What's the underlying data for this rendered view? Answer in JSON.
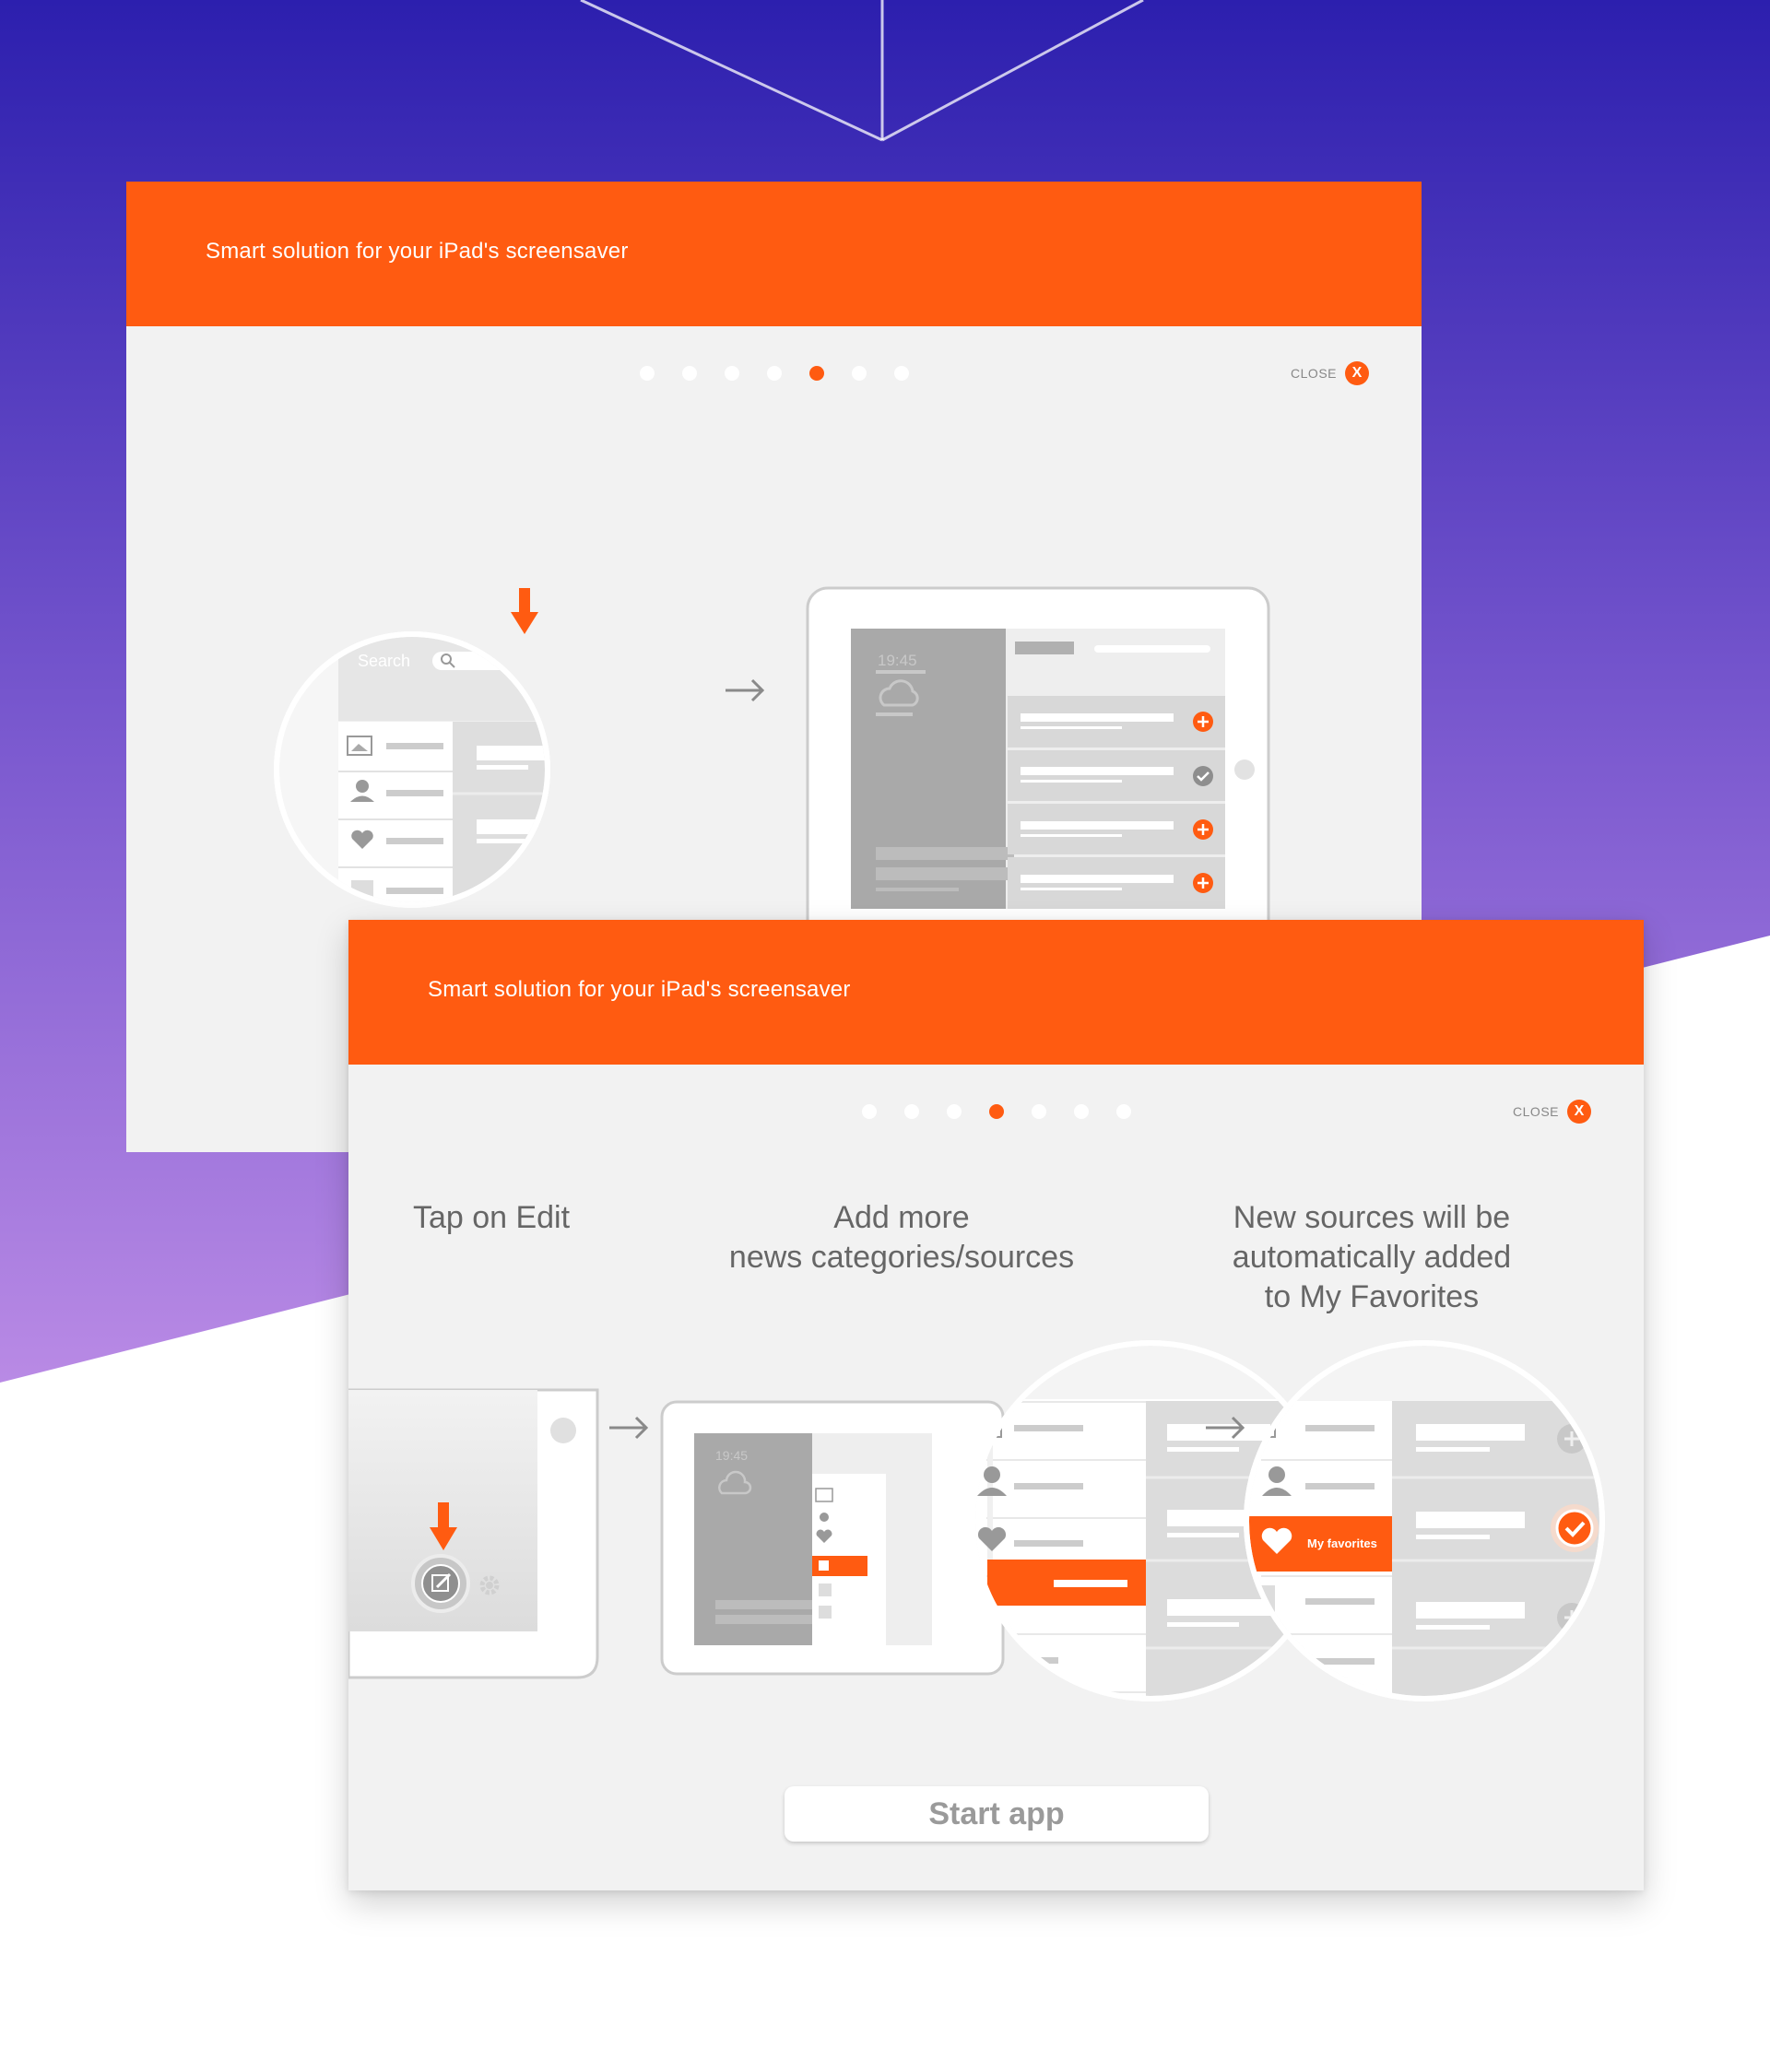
{
  "colors": {
    "accent": "#ff5b11",
    "panel": "#f2f2f2",
    "gradient_top": "#2c1fae",
    "gradient_bottom": "#b98ae5"
  },
  "back_panel": {
    "title": "Smart solution for your iPad's screensaver",
    "pagination": {
      "total": 7,
      "active": 5
    },
    "close_label": "CLOSE",
    "close_icon": "X",
    "search_placeholder": "Search",
    "clock": "19:45"
  },
  "front_panel": {
    "title": "Smart solution for your iPad's screensaver",
    "pagination": {
      "total": 7,
      "active": 4
    },
    "close_label": "CLOSE",
    "close_icon": "X",
    "steps": [
      {
        "caption": "Tap on Edit"
      },
      {
        "caption": "Add more\nnews categories/sources"
      },
      {
        "caption": "New sources will be\nautomatically added\nto My Favorites"
      }
    ],
    "clock": "19:45",
    "favorites_label": "My favorites",
    "start_button": "Start app"
  }
}
